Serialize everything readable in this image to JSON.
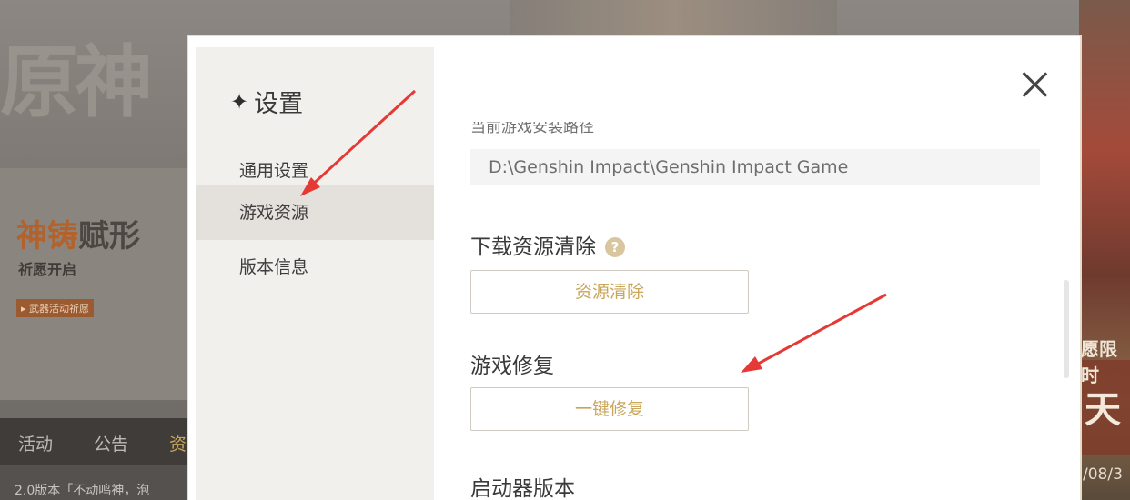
{
  "background": {
    "logo_text": "原神",
    "banner": {
      "title_highlight": "神铸",
      "title_rest": "赋形",
      "subtitle": "祈愿开启",
      "tag": "▸ 武器活动祈愿"
    },
    "tabs": [
      "活动",
      "公告",
      "资"
    ],
    "news_text": "2.0版本「不动鸣神，泡",
    "right_art_text1": "愿限时",
    "right_art_text2": "天",
    "right_art_text3": "/08/3"
  },
  "dialog": {
    "title": "设置",
    "title_icon": "four-point-star-icon",
    "nav": [
      {
        "label": "通用设置",
        "active": false
      },
      {
        "label": "游戏资源",
        "active": true
      },
      {
        "label": "版本信息",
        "active": false
      }
    ],
    "close_icon": "close-icon",
    "install_path": {
      "label": "当前游戏安装路径",
      "value": "D:\\Genshin Impact\\Genshin Impact Game"
    },
    "download_clear": {
      "title": "下载资源清除",
      "help_icon": "question-icon",
      "help_glyph": "?",
      "button": "资源清除"
    },
    "game_repair": {
      "title": "游戏修复",
      "button": "一键修复"
    },
    "launcher_version": {
      "title": "启动器版本"
    }
  },
  "colors": {
    "accent_gold": "#c9a65a",
    "annotation_red": "#e53935",
    "sidebar_bg": "#f2f0ed",
    "active_nav_bg": "#e4e1dd"
  }
}
